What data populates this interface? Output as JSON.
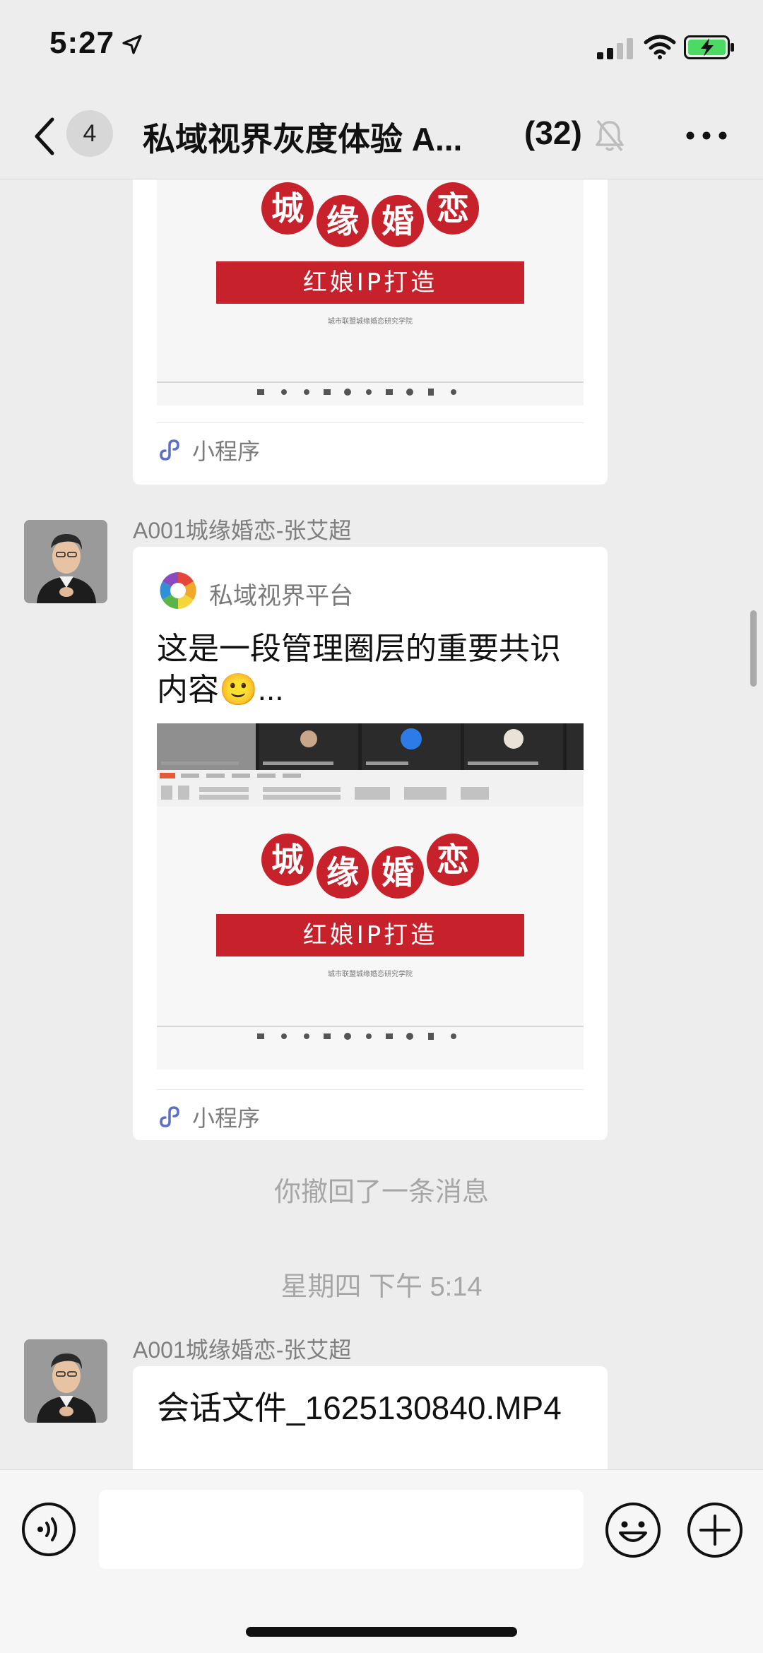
{
  "status_bar": {
    "time": "5:27"
  },
  "nav": {
    "unread_count": "4",
    "title": "私域视界灰度体验 A...",
    "member_count": "(32)"
  },
  "messages": {
    "first_card": {
      "slide_title_chars": [
        "城",
        "缘",
        "婚",
        "恋"
      ],
      "slide_ribbon": "红娘IP打造",
      "slide_subtitle": "城市联盟城缘婚恋研究学院",
      "mini_program_label": "小程序"
    },
    "second": {
      "sender": "A001城缘婚恋-张艾超",
      "source_name": "私域视界平台",
      "text": "这是一段管理圈层的重要共识内容🙂...",
      "slide_title_chars": [
        "城",
        "缘",
        "婚",
        "恋"
      ],
      "slide_ribbon": "红娘IP打造",
      "slide_subtitle": "城市联盟城缘婚恋研究学院",
      "mini_program_label": "小程序"
    },
    "recall_notice": "你撤回了一条消息",
    "timestamp": "星期四 下午 5:14",
    "third": {
      "sender": "A001城缘婚恋-张艾超",
      "file_name": "会话文件_1625130840.MP4"
    }
  },
  "input_bar": {
    "placeholder": ""
  },
  "colors": {
    "brand_red": "#c7212b",
    "background": "#ededed",
    "card": "#ffffff",
    "mini_program_icon": "#5b6ec9"
  },
  "icons": [
    "location-arrow-icon",
    "signal-icon",
    "wifi-icon",
    "battery-charging-icon",
    "back-chevron-icon",
    "mute-bell-icon",
    "more-icon",
    "mini-program-icon",
    "platform-logo-icon",
    "voice-icon",
    "emoji-icon",
    "plus-icon"
  ]
}
